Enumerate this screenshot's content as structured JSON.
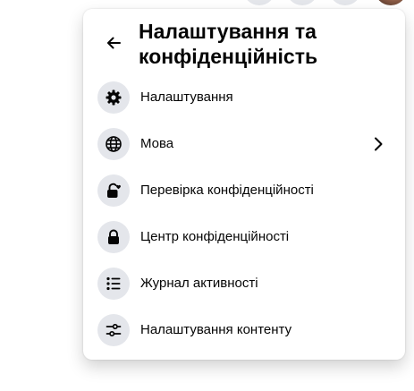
{
  "colors": {
    "menu_background": "#ffffff",
    "icon_circle": "#e4e6eb",
    "text_primary": "#050505"
  },
  "header": {
    "back_icon": "arrow-left-icon",
    "title": "Налаштування та конфіденційність"
  },
  "items": [
    {
      "label": "Налаштування",
      "icon": "gear-icon",
      "has_submenu": false
    },
    {
      "label": "Мова",
      "icon": "globe-icon",
      "has_submenu": true
    },
    {
      "label": "Перевірка конфіденційності",
      "icon": "lock-heart-icon",
      "has_submenu": false
    },
    {
      "label": "Центр конфіденційності",
      "icon": "lock-icon",
      "has_submenu": false
    },
    {
      "label": "Журнал активності",
      "icon": "list-icon",
      "has_submenu": false
    },
    {
      "label": "Налаштування контенту",
      "icon": "sliders-icon",
      "has_submenu": false
    }
  ]
}
